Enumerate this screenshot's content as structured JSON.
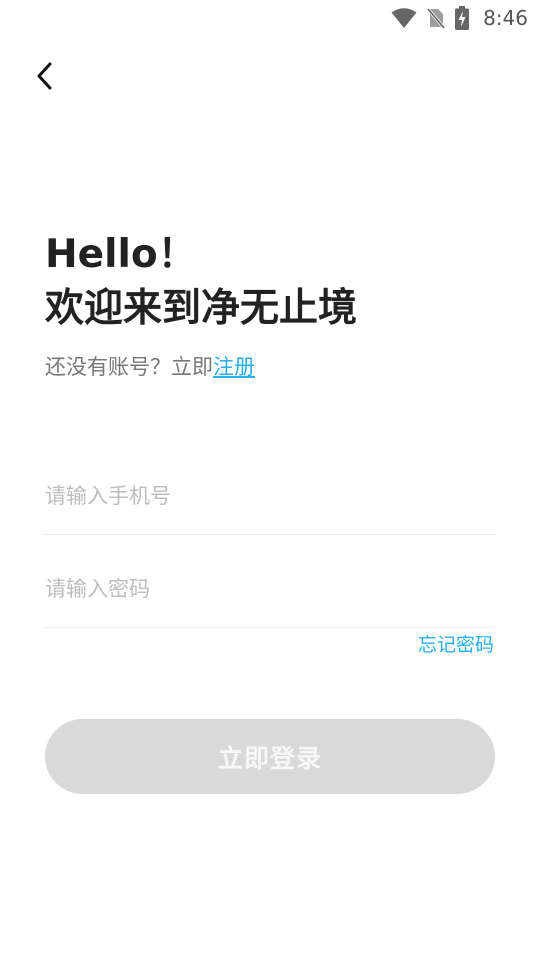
{
  "status_bar": {
    "time": "8:46",
    "icons": [
      "wifi-icon",
      "no-sim-icon",
      "battery-charging-icon"
    ]
  },
  "header": {
    "back_icon": "chevron-left-icon"
  },
  "main": {
    "greeting": "Hello！",
    "welcome": "欢迎来到净无止境",
    "register_prompt": "还没有账号？立即",
    "register_link": "注册",
    "phone_placeholder": "请输入手机号",
    "phone_value": "",
    "password_placeholder": "请输入密码",
    "password_value": "",
    "forgot_password": "忘记密码",
    "login_button": "立即登录"
  },
  "colors": {
    "accent": "#29aee8",
    "button_disabled": "#d9d9d9",
    "text_primary": "#222222",
    "text_secondary": "#777777"
  }
}
